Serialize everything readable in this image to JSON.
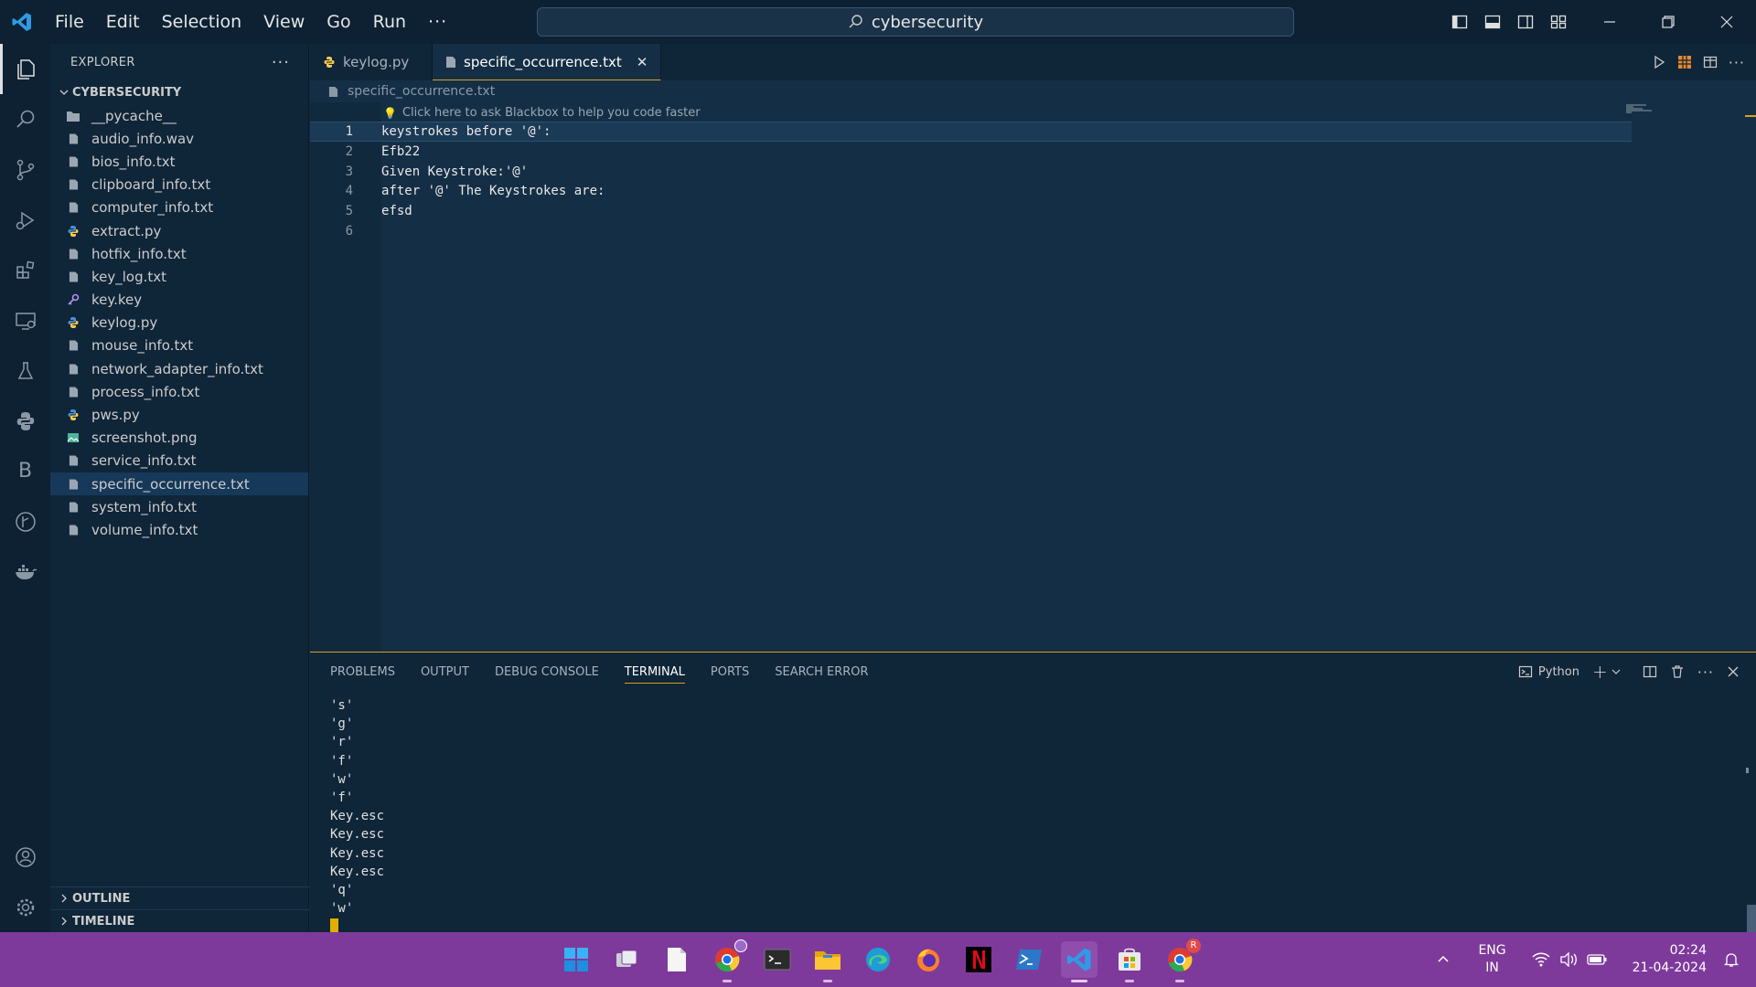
{
  "titlebar": {
    "menu": [
      "File",
      "Edit",
      "Selection",
      "View",
      "Go",
      "Run"
    ],
    "more": "···",
    "search_text": "cybersecurity"
  },
  "explorer": {
    "header": "EXPLORER",
    "more": "···",
    "folder_name": "CYBERSECURITY",
    "files": [
      {
        "name": "__pycache__",
        "type": "folder"
      },
      {
        "name": "audio_info.wav",
        "type": "file"
      },
      {
        "name": "bios_info.txt",
        "type": "file"
      },
      {
        "name": "clipboard_info.txt",
        "type": "file"
      },
      {
        "name": "computer_info.txt",
        "type": "file"
      },
      {
        "name": "extract.py",
        "type": "python"
      },
      {
        "name": "hotfix_info.txt",
        "type": "file"
      },
      {
        "name": "key_log.txt",
        "type": "file"
      },
      {
        "name": "key.key",
        "type": "key"
      },
      {
        "name": "keylog.py",
        "type": "python"
      },
      {
        "name": "mouse_info.txt",
        "type": "file"
      },
      {
        "name": "network_adapter_info.txt",
        "type": "file"
      },
      {
        "name": "process_info.txt",
        "type": "file"
      },
      {
        "name": "pws.py",
        "type": "python"
      },
      {
        "name": "screenshot.png",
        "type": "image"
      },
      {
        "name": "service_info.txt",
        "type": "file"
      },
      {
        "name": "specific_occurrence.txt",
        "type": "file",
        "selected": true
      },
      {
        "name": "system_info.txt",
        "type": "file"
      },
      {
        "name": "volume_info.txt",
        "type": "file"
      }
    ],
    "outline": "OUTLINE",
    "timeline": "TIMELINE"
  },
  "tabs": [
    {
      "label": "keylog.py",
      "active": false
    },
    {
      "label": "specific_occurrence.txt",
      "active": true
    }
  ],
  "breadcrumb": "specific_occurrence.txt",
  "editor": {
    "hint": "Click here to ask Blackbox to help you code faster",
    "lines": [
      {
        "num": "1",
        "text": "keystrokes before '@':"
      },
      {
        "num": "2",
        "text": "Efb22"
      },
      {
        "num": "3",
        "text": "Given Keystroke:'@'"
      },
      {
        "num": "4",
        "text": "after '@' The Keystrokes are:"
      },
      {
        "num": "5",
        "text": "efsd"
      },
      {
        "num": "6",
        "text": ""
      }
    ],
    "current_line": 1
  },
  "panel": {
    "tabs": [
      "PROBLEMS",
      "OUTPUT",
      "DEBUG CONSOLE",
      "TERMINAL",
      "PORTS",
      "SEARCH ERROR"
    ],
    "active_tab": "TERMINAL",
    "terminal_profile": "Python",
    "terminal_lines": [
      "'s'",
      "'g'",
      "'r'",
      "'f'",
      "'w'",
      "'f'",
      "Key.esc",
      "Key.esc",
      "Key.esc",
      "Key.esc",
      "'q'",
      "'w'"
    ]
  },
  "taskbar": {
    "lang_top": "ENG",
    "lang_bottom": "IN",
    "time": "02:24",
    "date": "21-04-2024",
    "chrome_badge": "R"
  },
  "colors": {
    "accent": "#d7a11f",
    "taskbar": "#7e3a9b",
    "editor_bg": "#142f45"
  }
}
